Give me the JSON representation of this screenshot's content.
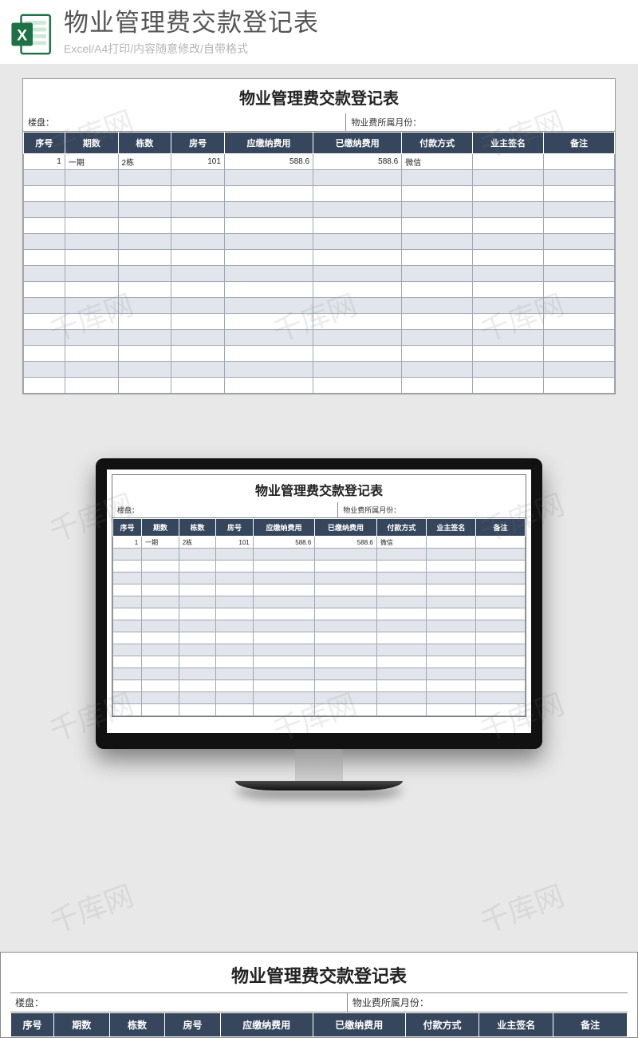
{
  "header": {
    "title": "物业管理费交款登记表",
    "subtitle": "Excel/A4打印/内容随意修改/自带格式"
  },
  "sheet": {
    "title": "物业管理费交款登记表",
    "subhead_left_label": "楼盘：",
    "subhead_right_label": "物业费所属月份：",
    "columns": [
      "序号",
      "期数",
      "栋数",
      "房号",
      "应缴纳费用",
      "已缴纳费用",
      "付款方式",
      "业主签名",
      "备注"
    ],
    "col_widths": [
      "7%",
      "9%",
      "9%",
      "9%",
      "15%",
      "15%",
      "12%",
      "12%",
      "12%"
    ],
    "rows": [
      {
        "seq": "1",
        "period": "一期",
        "building": "2栋",
        "room": "101",
        "due": "588.6",
        "paid": "588.6",
        "method": "微信",
        "sign": "",
        "note": ""
      }
    ],
    "blank_rows_main": 14,
    "blank_rows_monitor": 14
  },
  "watermark": "千库网"
}
